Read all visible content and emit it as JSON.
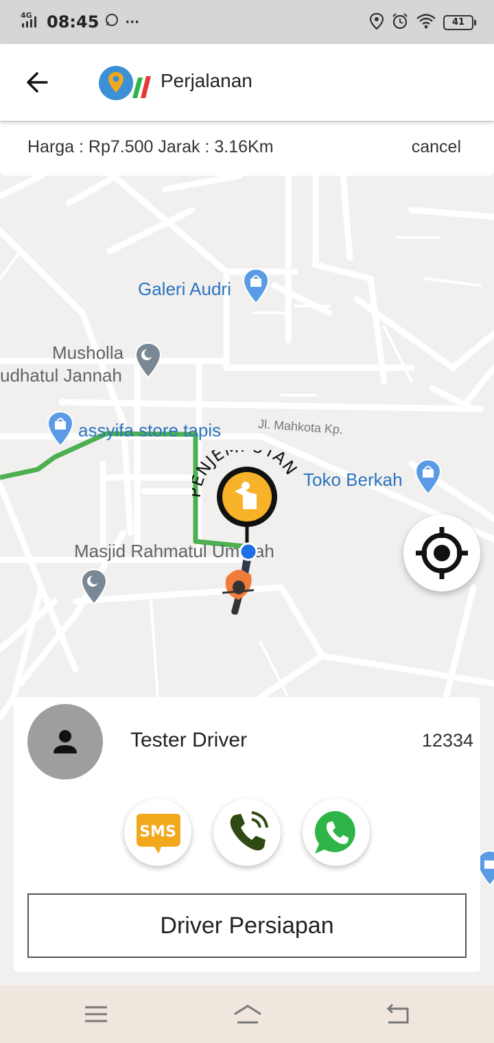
{
  "status_bar": {
    "network": "4G",
    "time": "08:45",
    "extra": "···",
    "battery": "41"
  },
  "app_bar": {
    "title": "Perjalanan"
  },
  "trip_info": {
    "summary": "Harga : Rp7.500 Jarak : 3.16Km",
    "cancel_label": "cancel"
  },
  "map": {
    "pois": [
      {
        "label": "Galeri Audri",
        "type": "shopping"
      },
      {
        "label": "Musholla",
        "type": "mosque"
      },
      {
        "label": "udhatul Jannah",
        "type": "mosque"
      },
      {
        "label": "assyifa store tapis",
        "type": "shopping"
      },
      {
        "label": "Toko Berkah",
        "type": "shopping"
      },
      {
        "label": "Masjid Rahmatul Ummah",
        "type": "mosque"
      }
    ],
    "street": "Jl. Mahkota Kp.",
    "pickup_label": "PENJEMPUTAN",
    "route_color": "#4caf50"
  },
  "driver": {
    "name": "Tester Driver",
    "id": "12334",
    "sms_label": "SMS",
    "status_button": "Driver Persiapan"
  },
  "colors": {
    "accent_blue": "#2b73c0",
    "sms_orange": "#f2a81d",
    "whatsapp_green": "#2fb447",
    "pickup_yellow": "#f7b22a"
  }
}
